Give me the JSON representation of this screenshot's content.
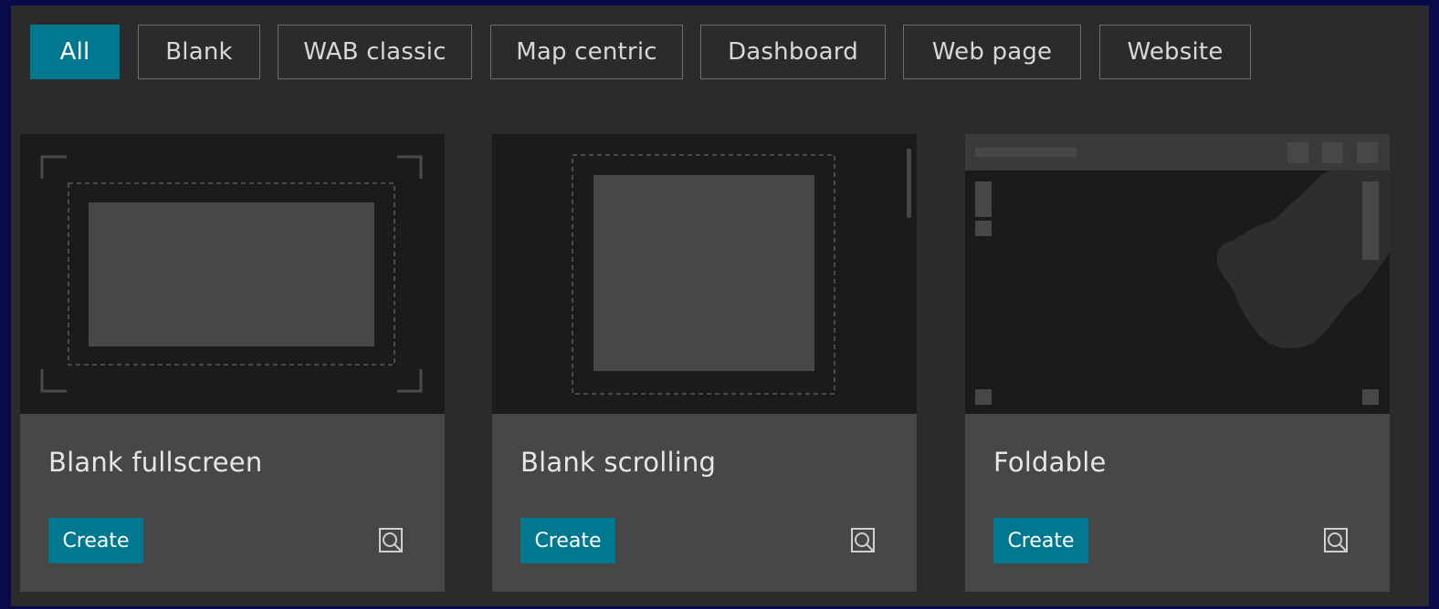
{
  "filters": [
    {
      "label": "All",
      "active": true
    },
    {
      "label": "Blank",
      "active": false
    },
    {
      "label": "WAB classic",
      "active": false
    },
    {
      "label": "Map centric",
      "active": false
    },
    {
      "label": "Dashboard",
      "active": false
    },
    {
      "label": "Web page",
      "active": false
    },
    {
      "label": "Website",
      "active": false
    }
  ],
  "cards": [
    {
      "title": "Blank fullscreen",
      "create_label": "Create",
      "preview_icon": "preview-icon",
      "thumbnail": "blank-fullscreen-thumbnail"
    },
    {
      "title": "Blank scrolling",
      "create_label": "Create",
      "preview_icon": "preview-icon",
      "thumbnail": "blank-scrolling-thumbnail"
    },
    {
      "title": "Foldable",
      "create_label": "Create",
      "preview_icon": "preview-icon",
      "thumbnail": "foldable-thumbnail"
    }
  ],
  "colors": {
    "accent": "#00788f",
    "background": "#2b2b2b",
    "card_info": "#474747",
    "thumbnail": "#1b1b1b",
    "page_border": "#0a0a4a"
  }
}
